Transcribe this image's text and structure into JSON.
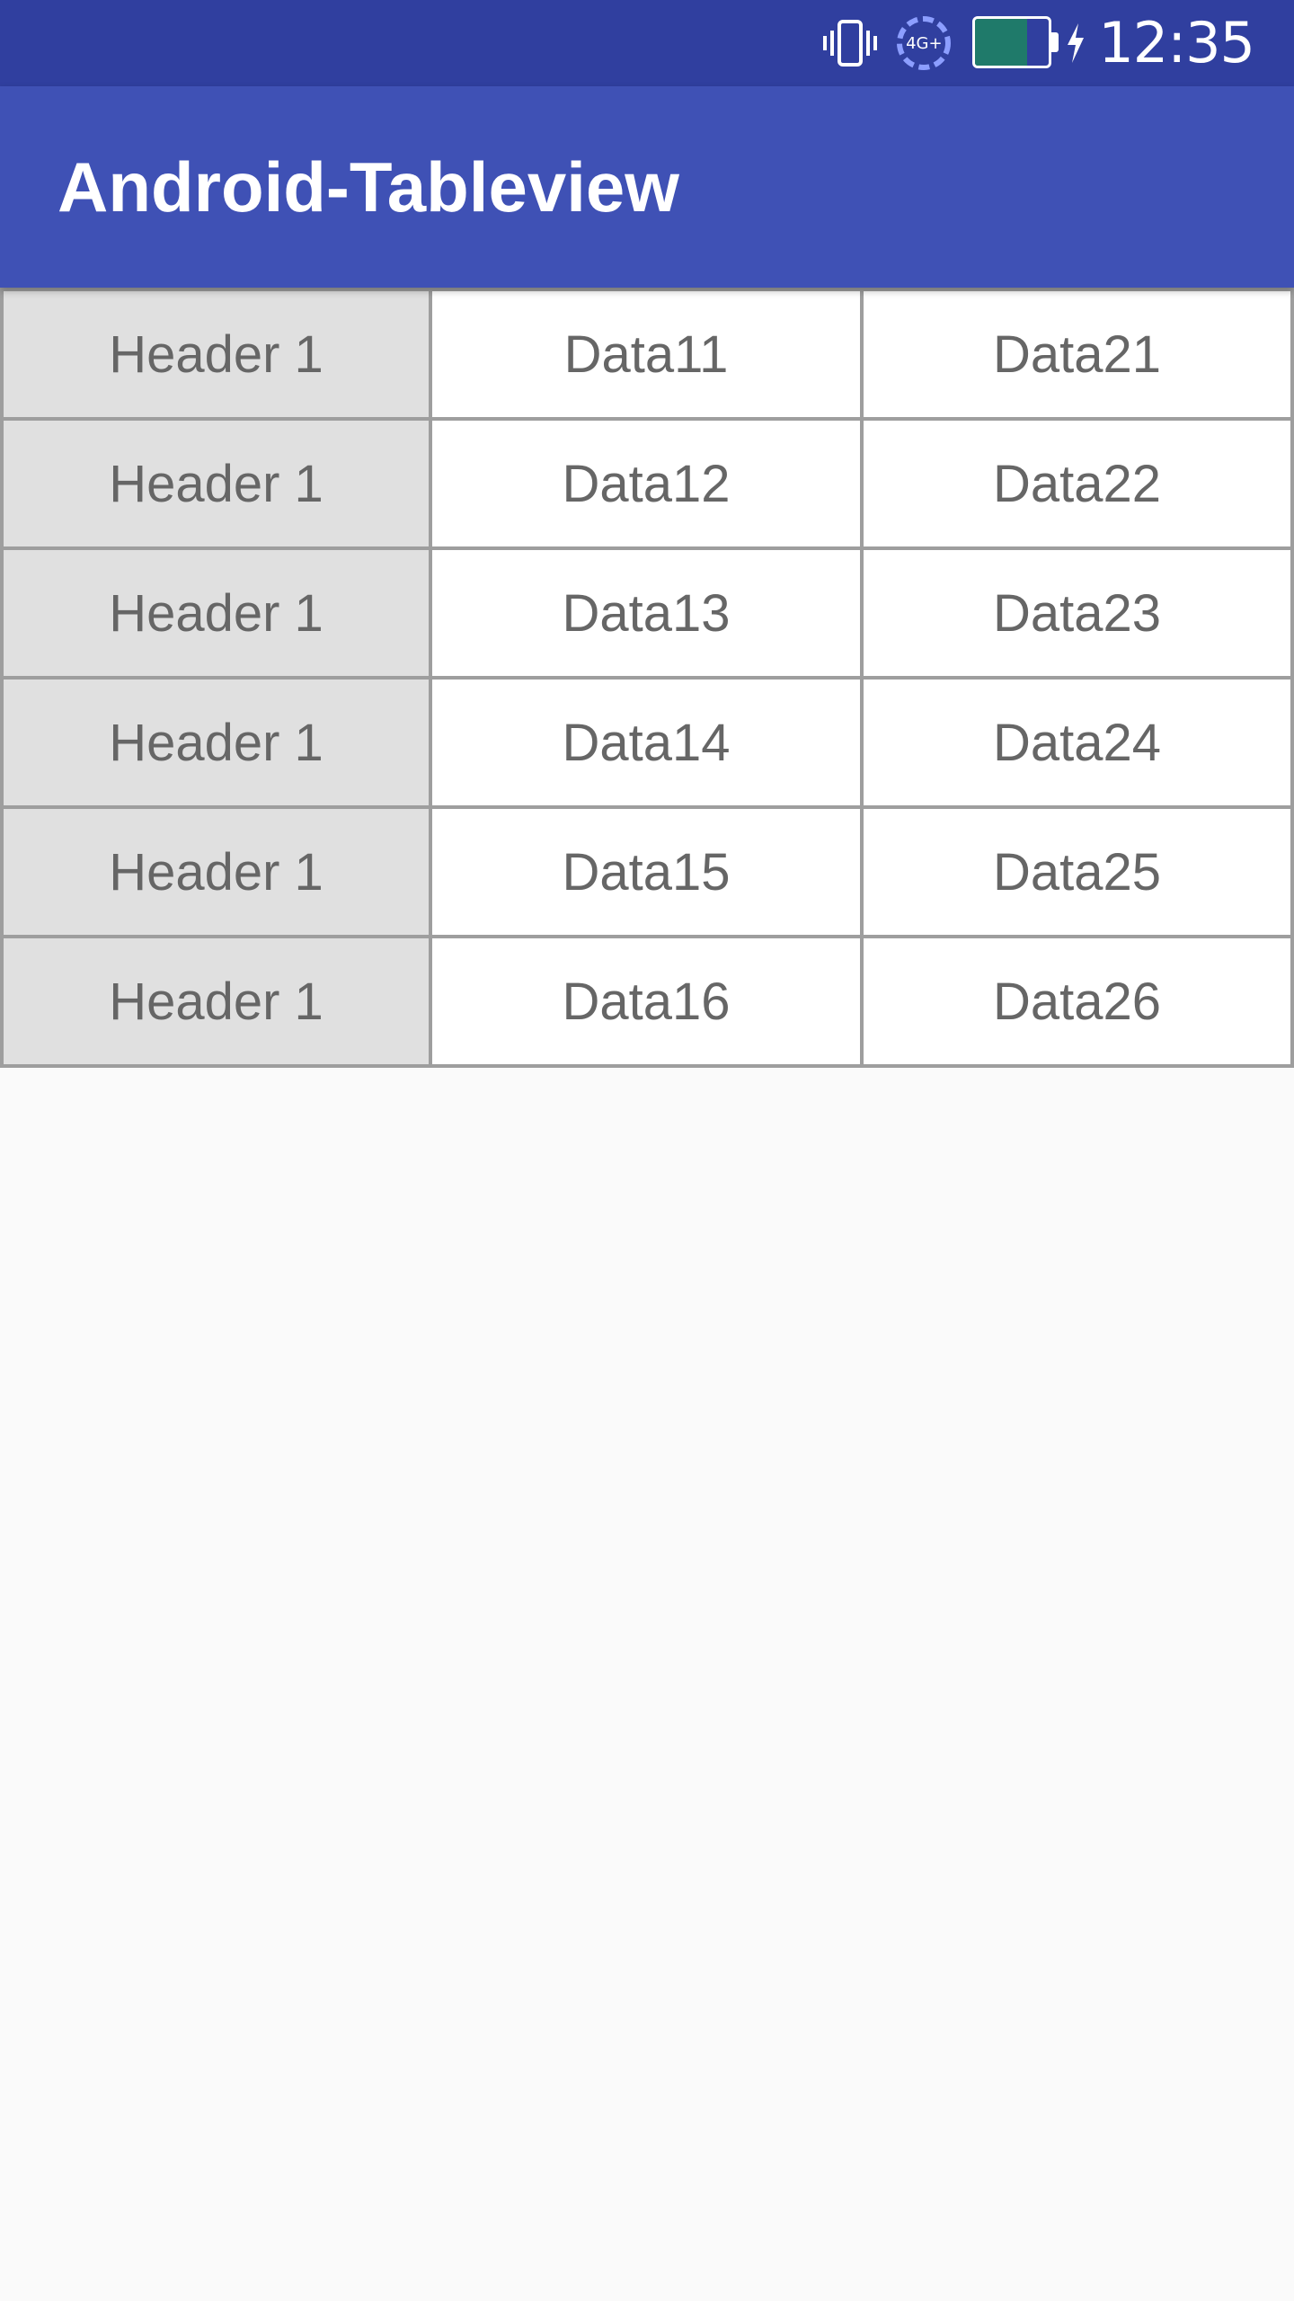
{
  "status_bar": {
    "time": "12:35",
    "network_label": "4G+",
    "battery_level": 0.7,
    "battery_color": "#1f7a6a",
    "icons": [
      "vibrate-icon",
      "network-icon",
      "battery-icon",
      "charging-icon"
    ]
  },
  "app_bar": {
    "title": "Android-Tableview",
    "color": "#3f51b5"
  },
  "table": {
    "rows": [
      {
        "header": "Header 1",
        "col1": "Data11",
        "col2": "Data21"
      },
      {
        "header": "Header 1",
        "col1": "Data12",
        "col2": "Data22"
      },
      {
        "header": "Header 1",
        "col1": "Data13",
        "col2": "Data23"
      },
      {
        "header": "Header 1",
        "col1": "Data14",
        "col2": "Data24"
      },
      {
        "header": "Header 1",
        "col1": "Data15",
        "col2": "Data25"
      },
      {
        "header": "Header 1",
        "col1": "Data16",
        "col2": "Data26"
      }
    ]
  }
}
